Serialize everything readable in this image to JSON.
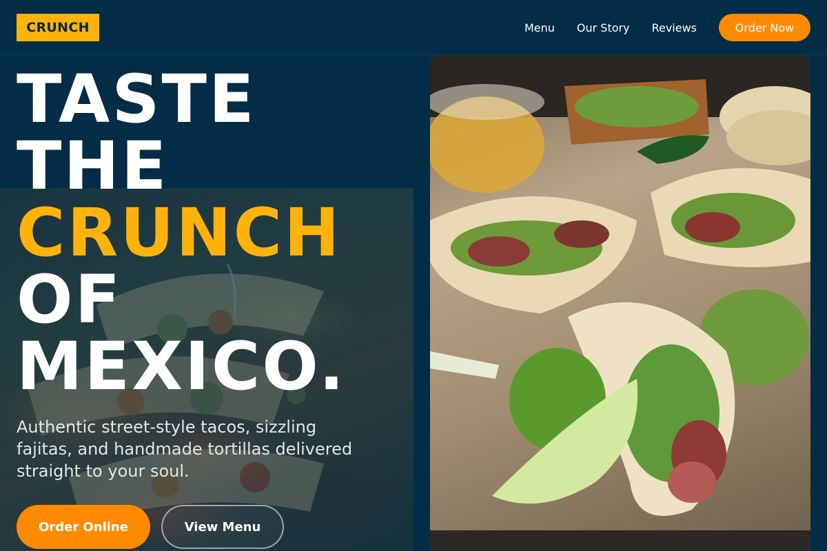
{
  "brand": {
    "logo_text": "CRUNCH",
    "accent_color": "#ffb30a",
    "cta_color": "#ff8a00",
    "background_color": "#032c47"
  },
  "nav": {
    "items": [
      {
        "label": "Menu"
      },
      {
        "label": "Our Story"
      },
      {
        "label": "Reviews"
      }
    ],
    "cta_label": "Order Now"
  },
  "hero": {
    "headline_line1": "TASTE",
    "headline_line2": "THE",
    "headline_accent": "CRUNCH",
    "headline_line4": "OF",
    "headline_line5": "MEXICO.",
    "subtitle": "Authentic street-style tacos, sizzling fajitas, and handmade tortillas delivered straight to your soul.",
    "primary_button": "Order Online",
    "secondary_button": "View Menu"
  },
  "images": {
    "background": "dimmed-tacos-photo",
    "hero": "steak-tacos-with-lime-photo"
  }
}
